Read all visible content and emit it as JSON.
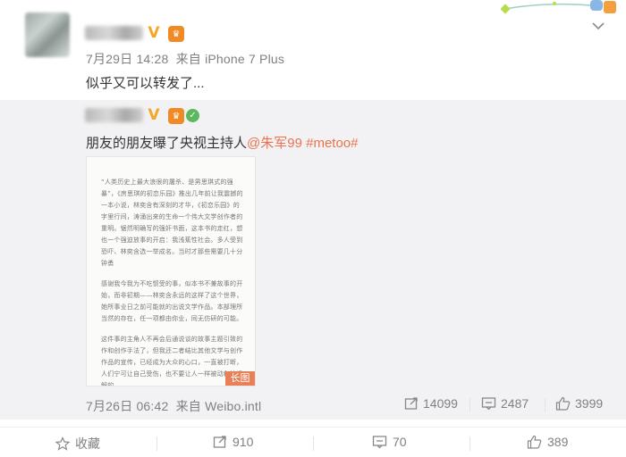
{
  "post": {
    "author_badges": [
      "v-badge-icon",
      "crown-badge-icon"
    ],
    "meta": {
      "date": "7月29日 14:28",
      "source_prefix": "来自",
      "source": "iPhone 7 Plus"
    },
    "text": "似乎又可以转发了..."
  },
  "repost": {
    "author_badges": [
      "v-badge-icon",
      "crown-badge-icon",
      "shield-badge-icon"
    ],
    "text_prefix": "朋友的朋友曝了央视主持人",
    "mention": "@朱军99",
    "hashtag": "#metoo#",
    "long_image_label": "长图",
    "long_image_paragraphs": [
      "“人类历史上最大浪很的屠杀、是男思琪式的强暴”，《房思琪的初恋乐园》推出几年前让我震撼的一本小说，林奕含有深刻的才华，《初恋乐园》的字里行间，涛涌出来的生命一个伟大文学创作者的重明。锯然明确写的强奸书面，这本书的走红，想也一个强迫放事的开启：我浅蕉性社会。多人受到恐吓、林奕含选一举成名。当时才那些需要几十分钟勇",
      "感谢我今我为不吃惯受的事，似本书不兼故事的开始，而非初期——林奕含永远的这样了这个世界，她所事业日之前可能就的出说文学作品。本部理所当然的存在，任一项都由你业，同无仿研的可能。",
      "这件事的主角人不再会后通说谈的故事主题引致的作和创作手法了，但我还二者结比其他文学与创作作品的宣传，已经成为大众的心口，一直被打断，人们宁可让自己受伤，也不要让人一样被动和被误解的。"
    ],
    "stats": {
      "date": "7月26日 06:42",
      "source_prefix": "来自",
      "source": "Weibo.intl",
      "reposts": "14099",
      "comments": "2487",
      "likes": "3999"
    }
  },
  "actions": {
    "favorite": "收藏",
    "reposts": "910",
    "comments": "70",
    "likes": "389"
  },
  "colors": {
    "link": "#eb7350",
    "repost_bg": "#f2f2f5",
    "muted": "#808080"
  }
}
